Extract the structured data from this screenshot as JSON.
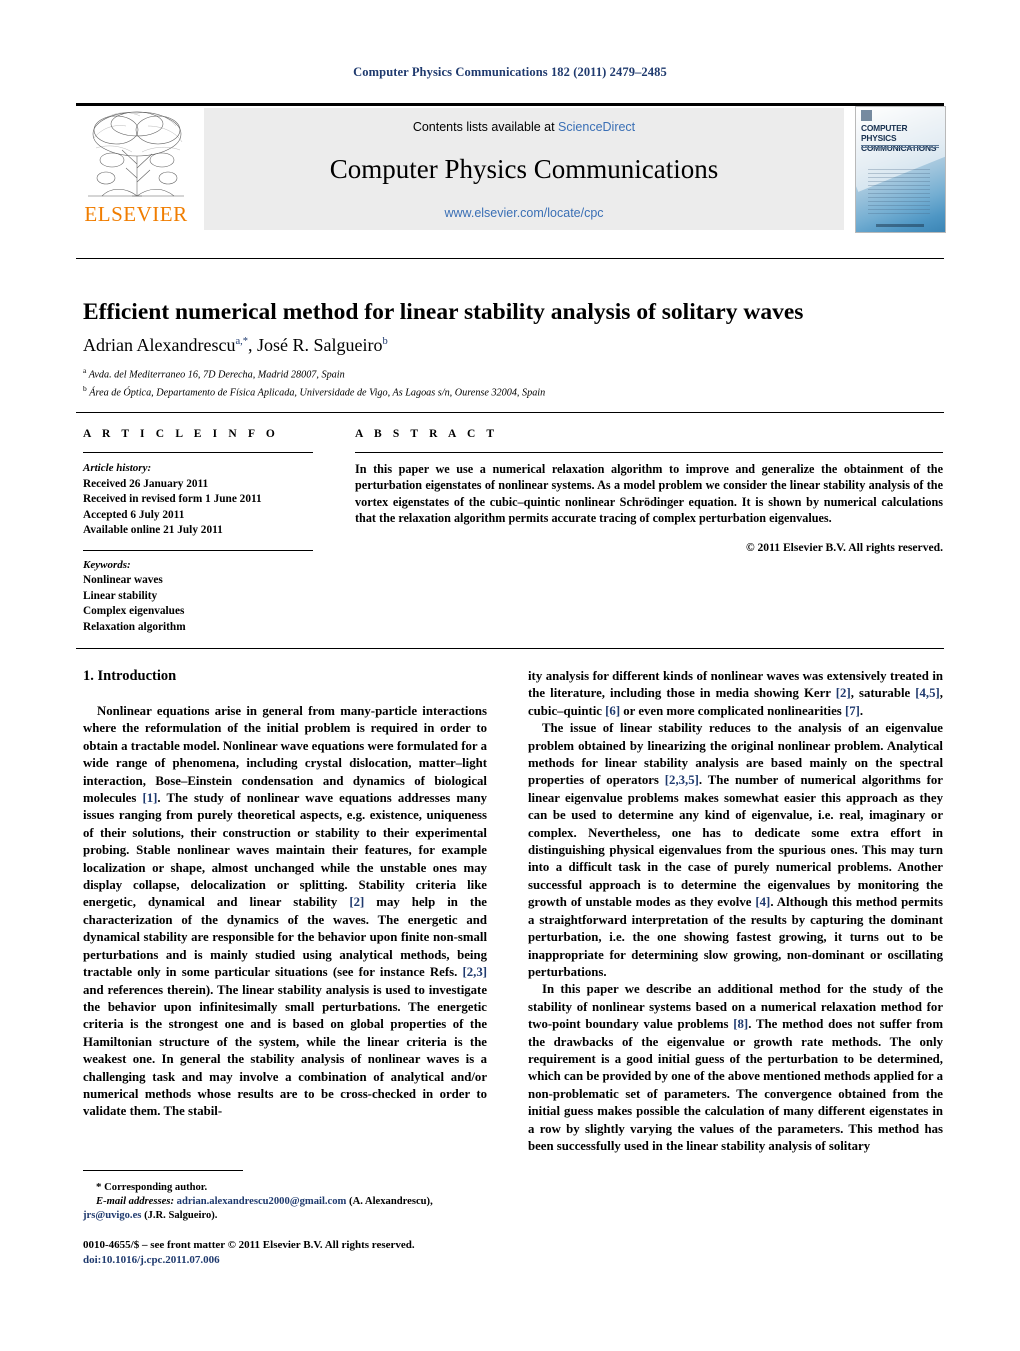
{
  "running_head": "Computer Physics Communications 182 (2011) 2479–2485",
  "masthead": {
    "contents_prefix": "Contents lists available at ",
    "sciencedirect": "ScienceDirect",
    "journal_title": "Computer Physics Communications",
    "journal_url": "www.elsevier.com/locate/cpc",
    "publisher_wordmark": "ELSEVIER",
    "cover_title_line1": "COMPUTER PHYSICS",
    "cover_title_line2": "COMMUNICATIONS"
  },
  "article": {
    "title": "Efficient numerical method for linear stability analysis of solitary waves",
    "authors_html": "Adrian Alexandrescu<sup>a,*</sup>, José R. Salgueiro<sup>b</sup>",
    "affiliation_a": "Avda. del Mediterraneo 16, 7D Derecha, Madrid 28007, Spain",
    "affiliation_b": "Área de Óptica, Departamento de Física Aplicada, Universidade de Vigo, As Lagoas s/n, Ourense 32004, Spain"
  },
  "info": {
    "heading": "A R T I C L E   I N F O",
    "history_label": "Article history:",
    "history": [
      "Received 26 January 2011",
      "Received in revised form 1 June 2011",
      "Accepted 6 July 2011",
      "Available online 21 July 2011"
    ],
    "keywords_label": "Keywords:",
    "keywords": [
      "Nonlinear waves",
      "Linear stability",
      "Complex eigenvalues",
      "Relaxation algorithm"
    ]
  },
  "abstract": {
    "heading": "A B S T R A C T",
    "text": "In this paper we use a numerical relaxation algorithm to improve and generalize the obtainment of the perturbation eigenstates of nonlinear systems. As a model problem we consider the linear stability analysis of the vortex eigenstates of the cubic–quintic nonlinear Schrödinger equation. It is shown by numerical calculations that the relaxation algorithm permits accurate tracing of complex perturbation eigenvalues.",
    "copyright": "© 2011 Elsevier B.V. All rights reserved."
  },
  "body": {
    "section_heading": "1. Introduction",
    "left_paragraph_1_html": "Nonlinear equations arise in general from many-particle interactions where the reformulation of the initial problem is required in order to obtain a tractable model. Nonlinear wave equations were formulated for a wide range of phenomena, including crystal dislocation, matter–light interaction, Bose–Einstein condensation and dynamics of biological molecules <span class=\"ref\">[1]</span>. The study of nonlinear wave equations addresses many issues ranging from purely theoretical aspects, e.g. existence, uniqueness of their solutions, their construction or stability to their experimental probing. Stable nonlinear waves maintain their features, for example localization or shape, almost unchanged while the unstable ones may display collapse, delocalization or splitting. Stability criteria like energetic, dynamical and linear stability <span class=\"ref\">[2]</span> may help in the characterization of the dynamics of the waves. The energetic and dynamical stability are responsible for the behavior upon finite non-small perturbations and is mainly studied using analytical methods, being tractable only in some particular situations (see for instance Refs. <span class=\"ref\">[2,3]</span> and references therein). The linear stability analysis is used to investigate the behavior upon infinitesimally small perturbations. The energetic criteria is the strongest one and is based on global properties of the Hamiltonian structure of the system, while the linear criteria is the weakest one. In general the stability analysis of nonlinear waves is a challenging task and may involve a combination of analytical and/or numerical methods whose results are to be cross-checked in order to validate them. The stabil-",
    "right_paragraph_1_html": "ity analysis for different kinds of nonlinear waves was extensively treated in the literature, including those in media showing Kerr <span class=\"ref\">[2]</span>, saturable <span class=\"ref\">[4,5]</span>, cubic–quintic <span class=\"ref\">[6]</span> or even more complicated nonlinearities <span class=\"ref\">[7]</span>.",
    "right_paragraph_2_html": "The issue of linear stability reduces to the analysis of an eigenvalue problem obtained by linearizing the original nonlinear problem. Analytical methods for linear stability analysis are based mainly on the spectral properties of operators <span class=\"ref\">[2,3,5]</span>. The number of numerical algorithms for linear eigenvalue problems makes somewhat easier this approach as they can be used to determine any kind of eigenvalue, i.e. real, imaginary or complex. Nevertheless, one has to dedicate some extra effort in distinguishing physical eigenvalues from the spurious ones. This may turn into a difficult task in the case of purely numerical problems. Another successful approach is to determine the eigenvalues by monitoring the growth of unstable modes as they evolve <span class=\"ref\">[4]</span>. Although this method permits a straightforward interpretation of the results by capturing the dominant perturbation, i.e. the one showing fastest growing, it turns out to be inappropriate for determining slow growing, non-dominant or oscillating perturbations.",
    "right_paragraph_3_html": "In this paper we describe an additional method for the study of the stability of nonlinear systems based on a numerical relaxation method for two-point boundary value problems <span class=\"ref\">[8]</span>. The method does not suffer from the drawbacks of the eigenvalue or growth rate methods. The only requirement is a good initial guess of the perturbation to be determined, which can be provided by one of the above mentioned methods applied for a non-problematic set of parameters. The convergence obtained from the initial guess makes possible the calculation of many different eigenstates in a row by slightly varying the values of the parameters. This method has been successfully used in the linear stability analysis of solitary"
  },
  "footnotes": {
    "corresponding_marker": "*",
    "corresponding_text": "Corresponding author.",
    "email_label": "E-mail addresses:",
    "email_1": "adrian.alexandrescu2000@gmail.com",
    "email_1_owner": "(A. Alexandrescu),",
    "email_2": "jrs@uvigo.es",
    "email_2_owner": "(J.R. Salgueiro)."
  },
  "imprint": {
    "issn_line": "0010-4655/$ – see front matter  © 2011 Elsevier B.V. All rights reserved.",
    "doi": "doi:10.1016/j.cpc.2011.07.006"
  }
}
